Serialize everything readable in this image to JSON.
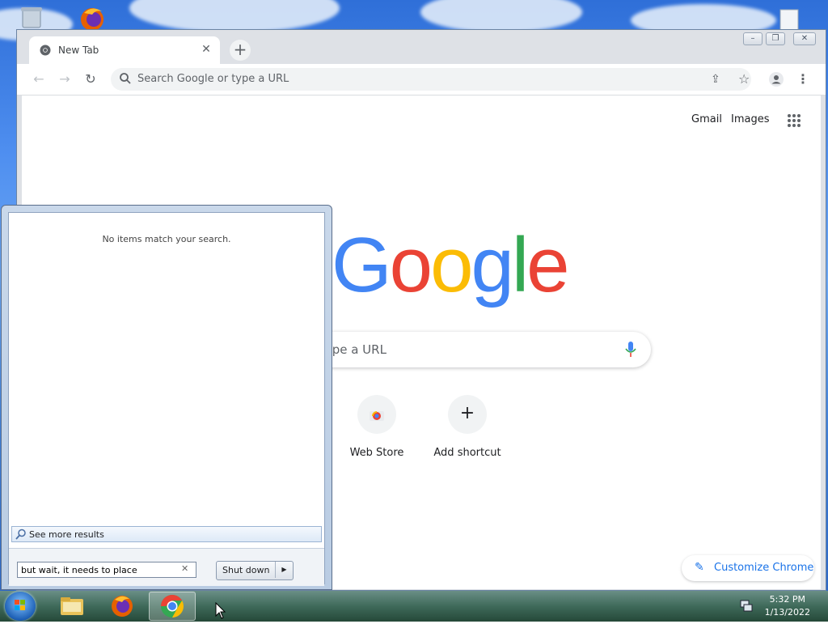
{
  "browser": {
    "tab": {
      "title": "New Tab"
    },
    "omnibox": {
      "placeholder": "Search Google or type a URL"
    },
    "toplinks": {
      "gmail": "Gmail",
      "images": "Images"
    },
    "logo_letters": [
      {
        "ch": "G",
        "color": "#4285F4"
      },
      {
        "ch": "o",
        "color": "#EA4335"
      },
      {
        "ch": "o",
        "color": "#FBBC05"
      },
      {
        "ch": "g",
        "color": "#4285F4"
      },
      {
        "ch": "l",
        "color": "#34A853"
      },
      {
        "ch": "e",
        "color": "#EA4335"
      }
    ],
    "search_box": {
      "visible_text": "r type a URL"
    },
    "shortcuts": [
      {
        "label": "Web Store",
        "icon": "web-store-icon"
      },
      {
        "label": "Add shortcut",
        "icon": "plus-icon"
      }
    ],
    "customize_label": "Customize Chrome",
    "accent_color": "#1a73e8"
  },
  "start_menu": {
    "no_items": "No items match your search.",
    "see_more": "See more results",
    "search_value": "but wait, it needs to place",
    "shutdown_label": "Shut down"
  },
  "taskbar": {
    "time": "5:32 PM",
    "date": "1/13/2022",
    "apps": [
      "file-explorer",
      "firefox",
      "chrome"
    ]
  }
}
